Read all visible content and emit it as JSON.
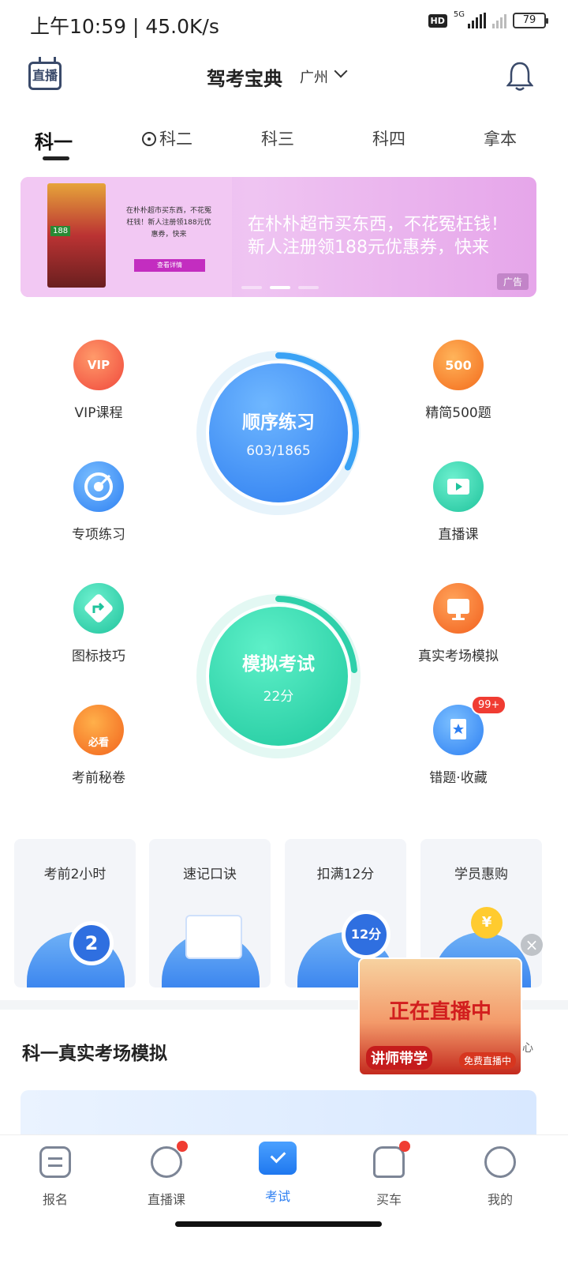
{
  "status": {
    "time": "上午10:59 | 45.0K/s",
    "hd": "HD",
    "network": "5G",
    "battery": "79"
  },
  "header": {
    "live_label": "直播",
    "title": "驾考宝典",
    "city": "广州"
  },
  "tabs": [
    "科一",
    "科二",
    "科三",
    "科四",
    "拿本"
  ],
  "banner": {
    "mini_text": "在朴朴超市买东西，不花冤枉钱！新人注册领188元优惠券，快来",
    "mini_button": "查看详情",
    "phone_tag": "188",
    "line1": "在朴朴超市买东西，不花冤枉钱！",
    "line2": "新人注册领188元优惠券，快来",
    "ad_label": "广告"
  },
  "features": {
    "vip": "VIP课程",
    "vip_glyph": "VIP",
    "special": "专项练习",
    "signs": "图标技巧",
    "secret": "考前秘卷",
    "secret_glyph": "必看",
    "simple500": "精简500题",
    "simple500_glyph": "500",
    "live_class": "直播课",
    "real_exam": "真实考场模拟",
    "wrong_fav": "错题·收藏",
    "wrong_badge": "99+"
  },
  "practice": {
    "title": "顺序练习",
    "progress": "603/1865",
    "fraction": 0.323
  },
  "mock": {
    "title": "模拟考试",
    "score": "22分"
  },
  "cards": [
    {
      "title": "考前2小时",
      "glyph": "2"
    },
    {
      "title": "速记口诀"
    },
    {
      "title": "扣满12分",
      "glyph": "12分"
    },
    {
      "title": "学员惠购",
      "glyph": "¥"
    }
  ],
  "section": {
    "title": "科一真实考场模拟",
    "more": "心"
  },
  "float_live": {
    "line1": "正在直播中",
    "line2": "讲师带学",
    "line3": "免费直播中"
  },
  "bottom_nav": [
    "报名",
    "直播课",
    "考试",
    "买车",
    "我的"
  ],
  "colors": {
    "accent": "#2d7ff2",
    "teal": "#2ed0aa",
    "badge": "#f03c32"
  }
}
